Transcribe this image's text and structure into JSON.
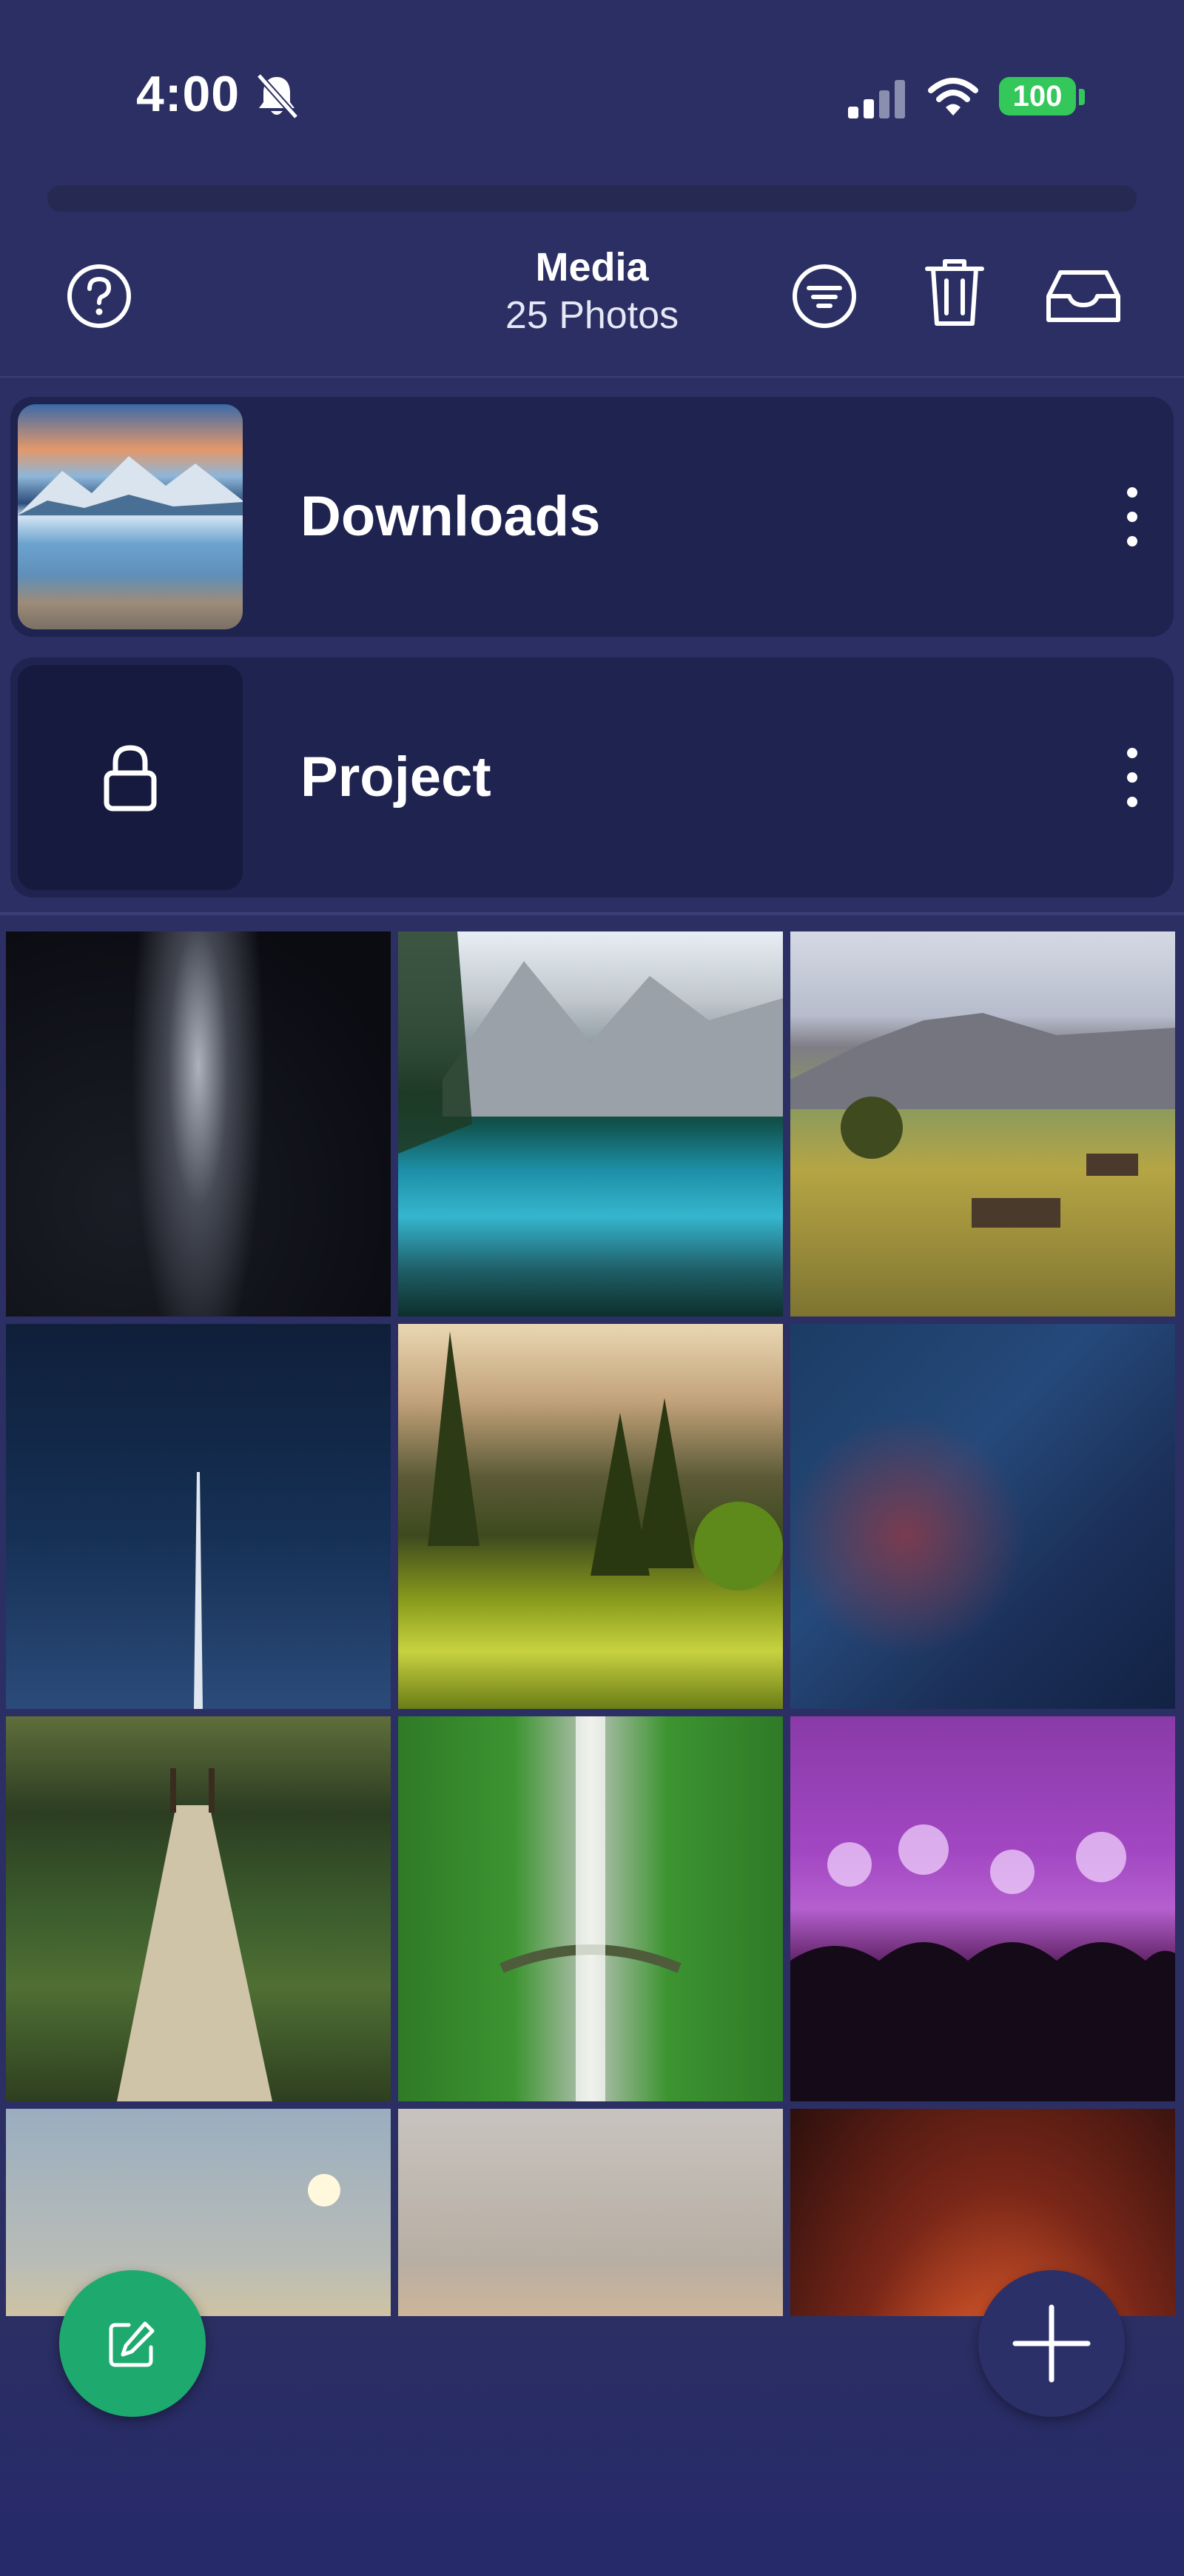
{
  "status_bar": {
    "time": "4:00",
    "battery": "100",
    "icons": [
      "bell-slash-icon",
      "signal-icon",
      "wifi-icon",
      "battery-icon"
    ]
  },
  "header": {
    "title": "Media",
    "subtitle": "25 Photos",
    "icons": [
      "help-icon",
      "filter-icon",
      "trash-icon",
      "inbox-icon"
    ]
  },
  "albums": [
    {
      "name": "Downloads",
      "locked": false
    },
    {
      "name": "Project",
      "locked": true
    }
  ],
  "photos": [
    {
      "subject": "milky-way"
    },
    {
      "subject": "mountain-lake"
    },
    {
      "subject": "alpine-meadow"
    },
    {
      "subject": "rocket-launch"
    },
    {
      "subject": "forest-sunrise"
    },
    {
      "subject": "starry-space"
    },
    {
      "subject": "rope-bridge"
    },
    {
      "subject": "waterfall"
    },
    {
      "subject": "concert-fireworks"
    },
    {
      "subject": "sea-sunset"
    },
    {
      "subject": "party-confetti"
    },
    {
      "subject": "bonfire"
    }
  ],
  "colors": {
    "background": "#2b2f63",
    "card": "#1f2350",
    "edit_fab": "#1eaa6e",
    "add_fab": "#2c3068",
    "battery": "#34c759"
  }
}
